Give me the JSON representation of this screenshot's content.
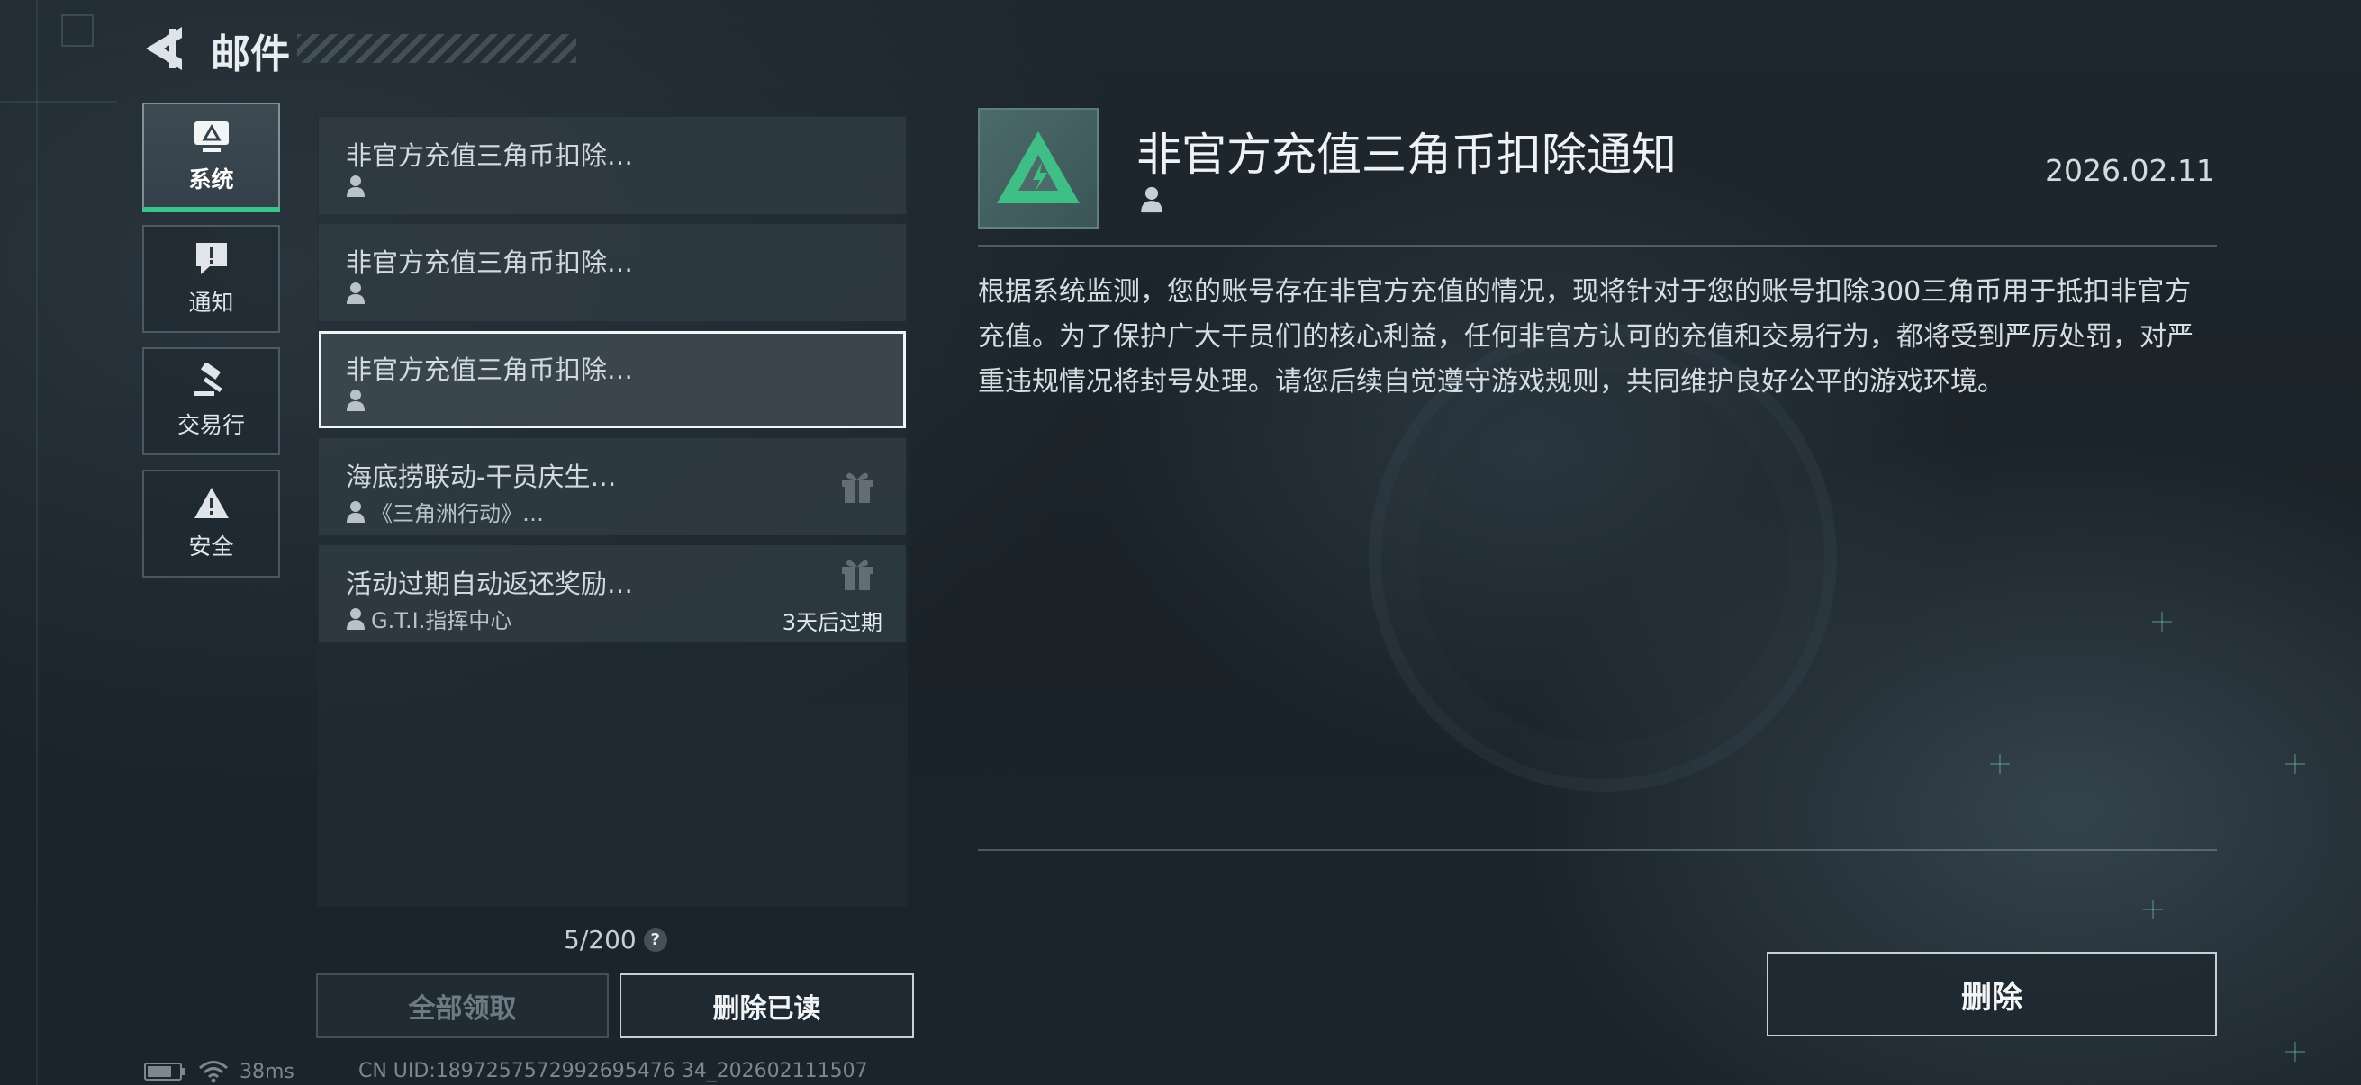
{
  "header": {
    "title": "邮件",
    "back_icon": "back-arrow-icon"
  },
  "sidebar": {
    "items": [
      {
        "label": "系统",
        "icon": "monitor-icon",
        "active": true
      },
      {
        "label": "通知",
        "icon": "alert-bubble-icon",
        "active": false
      },
      {
        "label": "交易行",
        "icon": "gavel-icon",
        "active": false
      },
      {
        "label": "安全",
        "icon": "warning-icon",
        "active": false
      }
    ]
  },
  "mail_list": {
    "items": [
      {
        "title": "非官方充值三角币扣除…",
        "sender": "",
        "has_gift": false,
        "selected": false,
        "expire": ""
      },
      {
        "title": "非官方充值三角币扣除…",
        "sender": "",
        "has_gift": false,
        "selected": false,
        "expire": ""
      },
      {
        "title": "非官方充值三角币扣除…",
        "sender": "",
        "has_gift": false,
        "selected": true,
        "expire": ""
      },
      {
        "title": "海底捞联动-干员庆生…",
        "sender": "《三角洲行动》…",
        "has_gift": true,
        "selected": false,
        "expire": ""
      },
      {
        "title": "活动过期自动返还奖励…",
        "sender": "G.T.I.指挥中心",
        "has_gift": true,
        "selected": false,
        "expire": "3天后过期"
      }
    ],
    "count": "5/200",
    "help": "?",
    "claim_all_label": "全部领取",
    "delete_read_label": "删除已读"
  },
  "status_bar": {
    "ping": "38ms",
    "uid": "CN UID:1897257572992695476 34_202602111507"
  },
  "detail": {
    "title": "非官方充值三角币扣除通知",
    "date": "2026.02.11",
    "body": "根据系统监测，您的账号存在非官方充值的情况，现将针对于您的账号扣除300三角币用于抵扣非官方充值。为了保护广大干员们的核心利益，任何非官方认可的充值和交易行为，都将受到严厉处罚，对严重违规情况将封号处理。请您后续自觉遵守游戏规则，共同维护良好公平的游戏环境。",
    "delete_label": "删除"
  },
  "colors": {
    "accent": "#38c48a",
    "background": "#1c252b"
  }
}
